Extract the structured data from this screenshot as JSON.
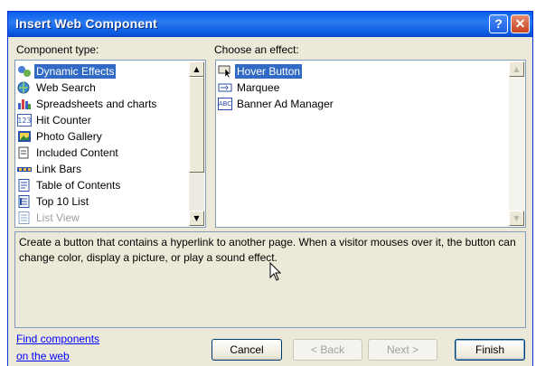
{
  "window": {
    "title": "Insert Web Component"
  },
  "titlebar": {
    "help_glyph": "?",
    "close_glyph": "✕"
  },
  "component_type": {
    "label": "Component type:",
    "items": [
      {
        "label": "Dynamic Effects",
        "icon": "dynamic-effects-icon",
        "selected": true
      },
      {
        "label": "Web Search",
        "icon": "globe-search-icon"
      },
      {
        "label": "Spreadsheets and charts",
        "icon": "spreadsheet-chart-icon"
      },
      {
        "label": "Hit Counter",
        "icon": "hit-counter-icon",
        "icon_text": "123"
      },
      {
        "label": "Photo Gallery",
        "icon": "photo-gallery-icon"
      },
      {
        "label": "Included Content",
        "icon": "included-content-icon"
      },
      {
        "label": "Link Bars",
        "icon": "link-bars-icon"
      },
      {
        "label": "Table of Contents",
        "icon": "table-of-contents-icon"
      },
      {
        "label": "Top 10 List",
        "icon": "top-10-list-icon"
      },
      {
        "label": "List View",
        "icon": "list-view-icon",
        "disabled": true
      }
    ]
  },
  "effects": {
    "label": "Choose an effect:",
    "items": [
      {
        "label": "Hover Button",
        "icon": "hover-button-icon",
        "selected": true
      },
      {
        "label": "Marquee",
        "icon": "marquee-icon"
      },
      {
        "label": "Banner Ad Manager",
        "icon": "banner-ad-icon",
        "icon_text": "ABC"
      }
    ]
  },
  "description": "Create a button that contains a hyperlink to another page.  When a visitor mouses over it, the button can change color, display a picture, or play a sound effect.",
  "footer": {
    "link_line1": "Find components",
    "link_line2": "on the web",
    "cancel": "Cancel",
    "back": "< Back",
    "next": "Next >",
    "finish": "Finish"
  }
}
